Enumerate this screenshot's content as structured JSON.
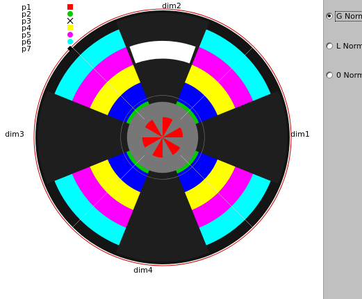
{
  "chart_data": {
    "type": "radial-bar",
    "legend": [
      {
        "label": "p1",
        "color": "#ff0000",
        "marker": "square"
      },
      {
        "label": "p2",
        "color": "#00cc00",
        "marker": "circle"
      },
      {
        "label": "p3",
        "color": "#000000",
        "marker": "x"
      },
      {
        "label": "p4",
        "color": "#ffff00",
        "marker": "square"
      },
      {
        "label": "p5",
        "color": "#ff00ff",
        "marker": "circle"
      },
      {
        "label": "p6",
        "color": "#00ffff",
        "marker": "circle"
      },
      {
        "label": "p7",
        "color": "#000000",
        "marker": "diamond"
      }
    ],
    "dimensions": [
      {
        "label": "dim1",
        "angle": 0
      },
      {
        "label": "dim2",
        "angle": 90
      },
      {
        "label": "dim3",
        "angle": 180
      },
      {
        "label": "dim4",
        "angle": 270
      }
    ],
    "bands": [
      {
        "color": "#ff0000",
        "inner": 0.0,
        "outer": 0.158
      },
      {
        "color": "#00cc00",
        "inner": 0.158,
        "outer": 0.308
      },
      {
        "color": "#0000ff",
        "inner": 0.308,
        "outer": 0.466
      },
      {
        "color": "#ffff00",
        "inner": 0.466,
        "outer": 0.617
      },
      {
        "color": "#ff00ff",
        "inner": 0.617,
        "outer": 0.767
      },
      {
        "color": "#00ffff",
        "inner": 0.767,
        "outer": 0.917
      }
    ],
    "dark_wedges": [
      {
        "color": "#000000",
        "inner": 0.0,
        "outer": 1.0
      },
      {
        "color": "#000000",
        "inner": 0.0,
        "outer": 1.0
      },
      {
        "color": "#000000",
        "inner": 0.0,
        "outer": 1.0
      },
      {
        "color": "#000000",
        "inner": 0.0,
        "outer": 1.0
      }
    ]
  },
  "controls": {
    "options": [
      {
        "label": "G Norm",
        "checked": true
      },
      {
        "label": "L Norm",
        "checked": false
      },
      {
        "label": "0 Norm",
        "checked": false
      }
    ]
  },
  "colors": {
    "panel_bg": "#c0c0c0",
    "plot_bg": "#ffffff",
    "disc": "#141414",
    "wedge": "#1e1e1e",
    "grid": "#777777",
    "center_gray": "#777777"
  }
}
